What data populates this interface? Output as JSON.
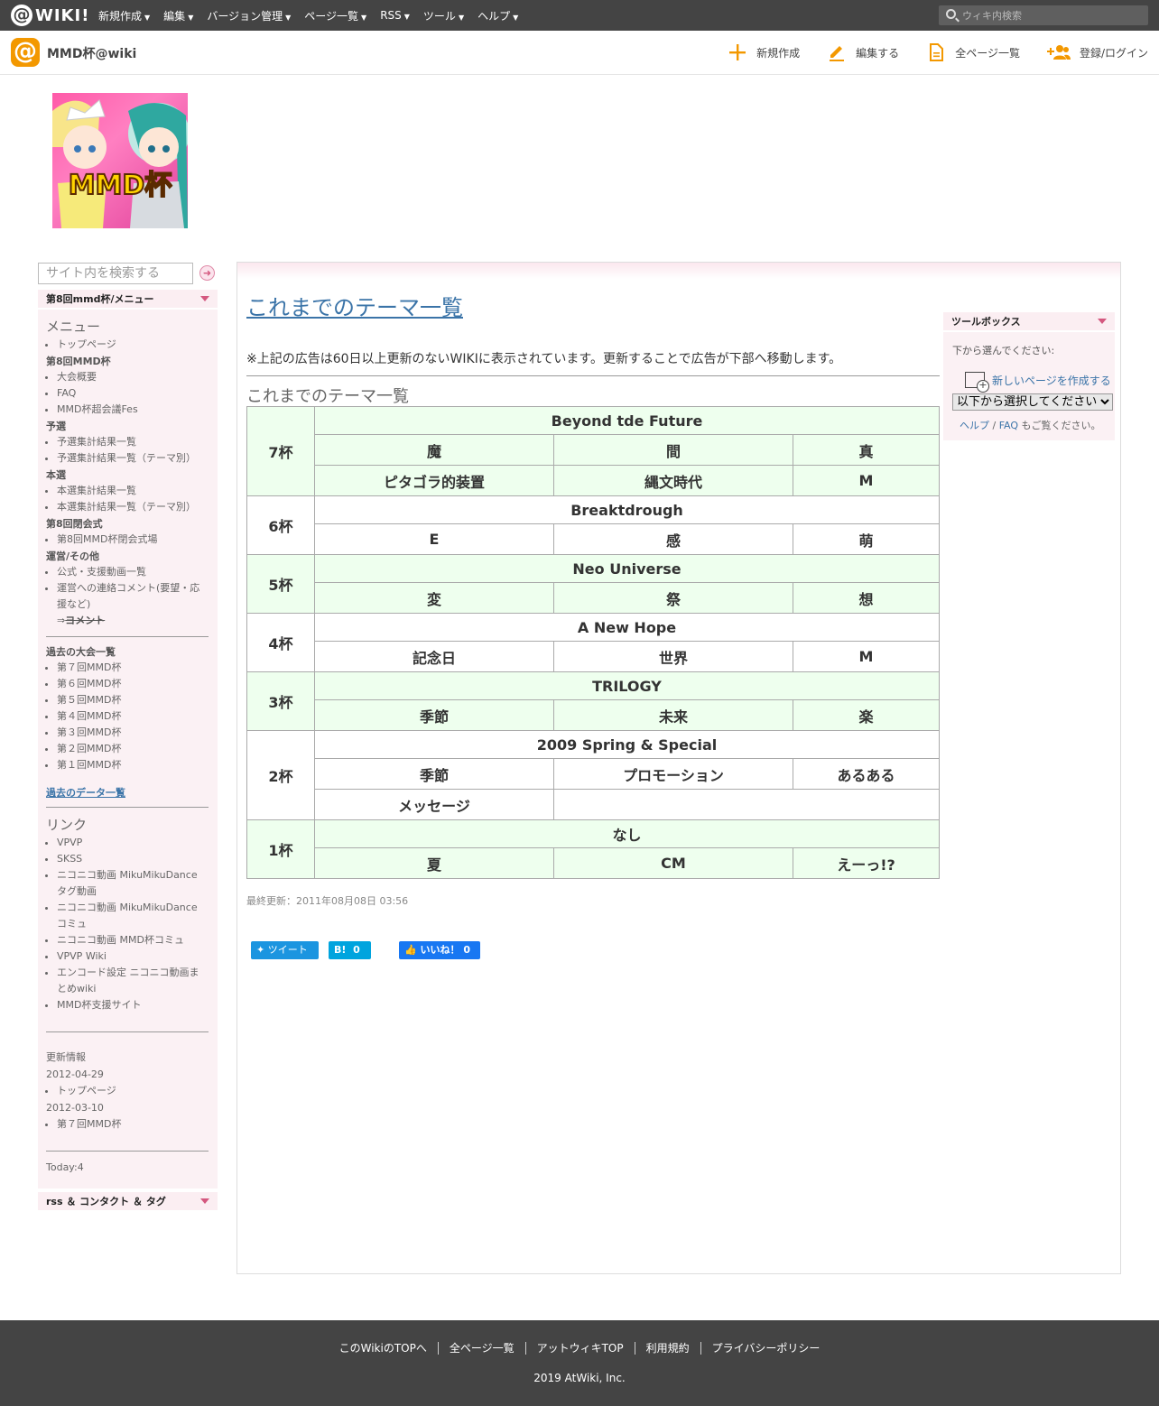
{
  "global": {
    "logo_text": "WIKI!",
    "menu": [
      "新規作成",
      "編集",
      "バージョン管理",
      "ページ一覧",
      "RSS",
      "ツール",
      "ヘルプ"
    ],
    "search_placeholder": "ウィキ内検索"
  },
  "header": {
    "site_title": "MMD杯@wiki",
    "actions": [
      "新規作成",
      "編集する",
      "全ページ一覧",
      "登録/ログイン"
    ]
  },
  "logo_image": {
    "text": "MMD杯"
  },
  "sidebar": {
    "search_placeholder": "サイト内を検索する",
    "menu_box_title": "第8回mmd杯/メニュー",
    "menu_title": "メニュー",
    "top_page": "トップページ",
    "group_cup8": "第8回MMD杯",
    "cup8_items": [
      "大会概要",
      "FAQ",
      "MMD杯超会議Fes"
    ],
    "group_yosen": "予選",
    "yosen_items": [
      "予選集計結果一覧",
      "予選集計結果一覧（テーマ別）"
    ],
    "group_honsen": "本選",
    "honsen_items": [
      "本選集計結果一覧",
      "本選集計結果一覧（テーマ別）"
    ],
    "group_closing": "第8回閉会式",
    "closing_items": [
      "第8回MMD杯閉会式場"
    ],
    "group_ops": "運営/その他",
    "ops_items": [
      "公式・支援動画一覧",
      "運営への連絡コメント(要望・応援など)"
    ],
    "ops_arrow": "⇒",
    "ops_strike": "ヨメント",
    "group_past": "過去の大会一覧",
    "past_items": [
      "第７回MMD杯",
      "第６回MMD杯",
      "第５回MMD杯",
      "第４回MMD杯",
      "第３回MMD杯",
      "第２回MMD杯",
      "第１回MMD杯"
    ],
    "past_data_link": "過去のデータ一覧",
    "links_title": "リンク",
    "link_items": [
      "VPVP",
      "SKSS",
      "ニコニコ動画 MikuMikuDance タグ動画",
      "ニコニコ動画 MikuMikuDance コミュ",
      "ニコニコ動画 MMD杯コミュ",
      "VPVP Wiki",
      "エンコード設定 ニコニコ動画まとめwiki",
      "MMD杯支援サイト"
    ],
    "updates_title": "更新情報",
    "updates": [
      {
        "date": "2012-04-29",
        "page": "トップページ"
      },
      {
        "date": "2012-03-10",
        "page": "第７回MMD杯"
      }
    ],
    "today": "Today:4",
    "rss_box_title": "rss ＆ コンタクト ＆ タグ"
  },
  "main": {
    "page_title": "これまでのテーマ一覧",
    "notice": "※上記の広告は60日以上更新のないWIKIに表示されています。更新することで広告が下部へ移動します。",
    "section_title": "これまでのテーマ一覧",
    "cups": [
      {
        "cup": "7杯",
        "title": "Beyond tde Future",
        "rows": [
          [
            "魔",
            "間",
            "真"
          ],
          [
            "ピタゴラ的装置",
            "縄文時代",
            "M"
          ]
        ]
      },
      {
        "cup": "6杯",
        "title": "Breaktdrough",
        "rows": [
          [
            "E",
            "感",
            "萌"
          ]
        ]
      },
      {
        "cup": "5杯",
        "title": "Neo Universe",
        "rows": [
          [
            "変",
            "祭",
            "想"
          ]
        ]
      },
      {
        "cup": "4杯",
        "title": "A New Hope",
        "rows": [
          [
            "記念日",
            "世界",
            "M"
          ]
        ]
      },
      {
        "cup": "3杯",
        "title": "TRILOGY",
        "rows": [
          [
            "季節",
            "未来",
            "楽"
          ]
        ]
      },
      {
        "cup": "2杯",
        "title": "2009 Spring & Special",
        "rows": [
          [
            "季節",
            "プロモーション",
            "あるある"
          ],
          [
            "メッセージ",
            "",
            ""
          ]
        ]
      },
      {
        "cup": "1杯",
        "title": "なし",
        "rows": [
          [
            "夏",
            "CM",
            "えーっ!?"
          ]
        ]
      }
    ],
    "last_updated": "最終更新：2011年08月08日 03:56",
    "share": {
      "tweet": "ツイート",
      "hatena_count": "0",
      "like": "いいね！",
      "like_count": "0"
    }
  },
  "toolbox": {
    "title": "ツールボックス",
    "prompt": "下から選んでください:",
    "new_page": "新しいページを作成する",
    "select_value": "以下から選択してください",
    "help": "ヘルプ",
    "faq": "FAQ",
    "help_suffix": "もご覧ください。"
  },
  "footer": {
    "links": [
      "このWikiのTOPへ",
      "全ページ一覧",
      "アットウィキTOP",
      "利用規約",
      "プライバシーポリシー"
    ],
    "copyright": "2019 AtWiki, Inc."
  },
  "colors": {
    "topbar": "#444444",
    "accent_orange": "#f39800",
    "sidebar_pink": "#fbf1f4",
    "table_green": "#eeffee",
    "link_blue": "#3b74a8"
  }
}
